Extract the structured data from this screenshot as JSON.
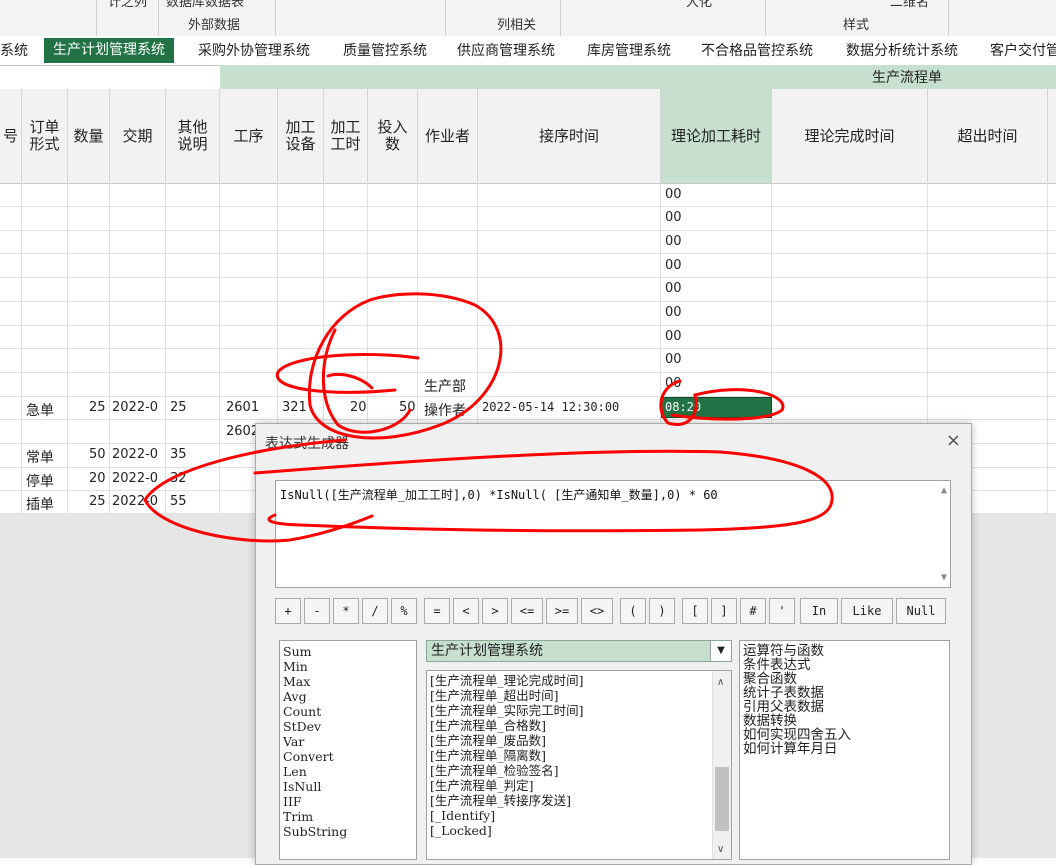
{
  "ribbon": {
    "top_left": "计之列",
    "top_mid": "数据库数据表",
    "top_right1": "大化",
    "top_right2": "二维名",
    "group_external": "外部数据",
    "group_columns": "列相关",
    "group_style": "样式"
  },
  "tabs": [
    {
      "label": "系统"
    },
    {
      "label": "生产计划管理系统",
      "active": true
    },
    {
      "label": "采购外协管理系统"
    },
    {
      "label": "质量管控系统"
    },
    {
      "label": "供应商管理系统"
    },
    {
      "label": "库房管理系统"
    },
    {
      "label": "不合格品管控系统"
    },
    {
      "label": "数据分析统计系统"
    },
    {
      "label": "客户交付管"
    }
  ],
  "band": {
    "title": "生产流程单"
  },
  "columns": {
    "c0": "号",
    "c1a": "订单",
    "c1b": "形式",
    "c2": "数量",
    "c3": "交期",
    "c4a": "其他",
    "c4b": "说明",
    "c5": "工序",
    "c6a": "加工",
    "c6b": "设备",
    "c7a": "加工",
    "c7b": "工时",
    "c8a": "投入",
    "c8b": "数",
    "c9": "作业者",
    "c10": "接序时间",
    "c11": "理论加工耗时",
    "c12": "理论完成时间",
    "c13": "超出时间"
  },
  "grid": {
    "zero_values": [
      "00",
      "00",
      "00",
      "00",
      "00",
      "00",
      "00",
      "00",
      "00"
    ],
    "dept_label": "生产部",
    "rows": [
      {
        "type": "急单",
        "qty": "25",
        "due": "2022-0",
        "other": "25",
        "proc": "2601",
        "equip": "321",
        "hours": "20",
        "input": "50",
        "worker": "操作者",
        "time": "2022-05-14 12:30:00",
        "theory": "08:20"
      },
      {
        "proc": "2602"
      },
      {
        "type": "常单",
        "qty": "50",
        "due": "2022-0",
        "other": "35"
      },
      {
        "type": "停单",
        "qty": "20",
        "due": "2022-0",
        "other": "32"
      },
      {
        "type": "插单",
        "qty": "25",
        "due": "2022-0",
        "other": "55"
      }
    ]
  },
  "dialog": {
    "title": "表达式生成器",
    "close": "×",
    "expression": "IsNull([生产流程单_加工工时],0) *IsNull( [生产通知单_数量],0) * 60",
    "operators": [
      "+",
      "-",
      "*",
      "/",
      "%",
      "=",
      "<",
      ">",
      "<=",
      ">=",
      "<>",
      "(",
      ")",
      "[",
      "]",
      "#",
      "'",
      "In",
      "Like",
      "Null"
    ],
    "functions": [
      "Sum",
      "Min",
      "Max",
      "Avg",
      "Count",
      "StDev",
      "Var",
      "Convert",
      "Len",
      "IsNull",
      "IIF",
      "Trim",
      "SubString"
    ],
    "combo_value": "生产计划管理系统",
    "fields": [
      "[生产流程单_理论完成时间]",
      "[生产流程单_超出时间]",
      "[生产流程单_实际完工时间]",
      "[生产流程单_合格数]",
      "[生产流程单_废品数]",
      "[生产流程单_隔离数]",
      "[生产流程单_检验签名]",
      "[生产流程单_判定]",
      "[生产流程单_转接序发送]",
      "[_Identify]",
      "[_Locked]"
    ],
    "help_items": [
      "运算符与函数",
      "条件表达式",
      "聚合函数",
      "统计子表数据",
      "引用父表数据",
      "数据转换",
      "如何实现四舍五入",
      "如何计算年月日"
    ]
  },
  "colors": {
    "accent_green": "#217346",
    "header_green": "#c6dfce",
    "ink_red": "#ff0000"
  }
}
